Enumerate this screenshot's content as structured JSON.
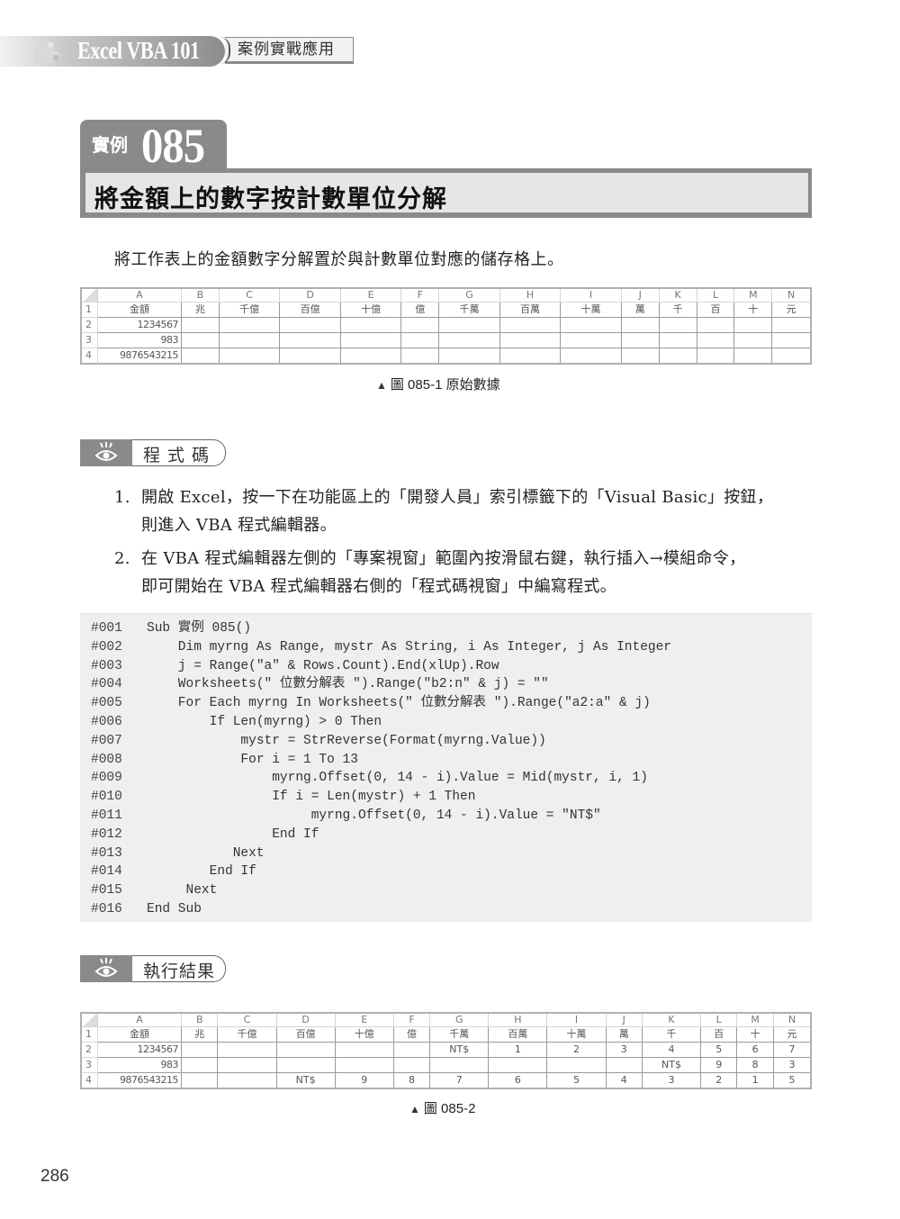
{
  "header": {
    "book_title": "Excel VBA 101",
    "book_subtitle": "案例實戰應用"
  },
  "example": {
    "label": "實例",
    "number": "085",
    "title": "將金額上的數字按計數單位分解"
  },
  "intro": "將工作表上的金額數字分解置於與計數單位對應的儲存格上。",
  "sheet_original": {
    "columns": [
      "A",
      "B",
      "C",
      "D",
      "E",
      "F",
      "G",
      "H",
      "I",
      "J",
      "K",
      "L",
      "M",
      "N"
    ],
    "rows": [
      {
        "num": "1",
        "cells": [
          "金額",
          "兆",
          "千億",
          "百億",
          "十億",
          "億",
          "千萬",
          "百萬",
          "十萬",
          "萬",
          "千",
          "百",
          "十",
          "元"
        ]
      },
      {
        "num": "2",
        "cells": [
          "1234567",
          "",
          "",
          "",
          "",
          "",
          "",
          "",
          "",
          "",
          "",
          "",
          "",
          ""
        ]
      },
      {
        "num": "3",
        "cells": [
          "983",
          "",
          "",
          "",
          "",
          "",
          "",
          "",
          "",
          "",
          "",
          "",
          "",
          ""
        ]
      },
      {
        "num": "4",
        "cells": [
          "9876543215",
          "",
          "",
          "",
          "",
          "",
          "",
          "",
          "",
          "",
          "",
          "",
          "",
          ""
        ]
      }
    ]
  },
  "caption1": {
    "marker": "▲",
    "text": "圖 085-1 原始數據"
  },
  "section_code": {
    "label": "程式碼"
  },
  "steps": [
    {
      "num": "1.",
      "line1": "開啟 Excel，按一下在功能區上的「開發人員」索引標籤下的「Visual Basic」按鈕，",
      "line2": "則進入 VBA 程式編輯器。"
    },
    {
      "num": "2.",
      "line1": "在 VBA 程式編輯器左側的「專案視窗」範圍內按滑鼠右鍵，執行插入→模組命令，",
      "line2": "即可開始在 VBA 程式編輯器右側的「程式碼視窗」中編寫程式。"
    }
  ],
  "code": [
    {
      "ln": "#001",
      "text": "Sub 實例 085()"
    },
    {
      "ln": "#002",
      "text": "    Dim myrng As Range, mystr As String, i As Integer, j As Integer"
    },
    {
      "ln": "#003",
      "text": "    j = Range(\"a\" & Rows.Count).End(xlUp).Row"
    },
    {
      "ln": "#004",
      "text": "    Worksheets(\" 位數分解表 \").Range(\"b2:n\" & j) = \"\""
    },
    {
      "ln": "#005",
      "text": "    For Each myrng In Worksheets(\" 位數分解表 \").Range(\"a2:a\" & j)"
    },
    {
      "ln": "#006",
      "text": "        If Len(myrng) > 0 Then"
    },
    {
      "ln": "#007",
      "text": "            mystr = StrReverse(Format(myrng.Value))"
    },
    {
      "ln": "#008",
      "text": "            For i = 1 To 13"
    },
    {
      "ln": "#009",
      "text": "                myrng.Offset(0, 14 - i).Value = Mid(mystr, i, 1)"
    },
    {
      "ln": "#010",
      "text": "                If i = Len(mystr) + 1 Then"
    },
    {
      "ln": "#011",
      "text": "                     myrng.Offset(0, 14 - i).Value = \"NT$\""
    },
    {
      "ln": "#012",
      "text": "                End If"
    },
    {
      "ln": "#013",
      "text": "           Next"
    },
    {
      "ln": "#014",
      "text": "        End If"
    },
    {
      "ln": "#015",
      "text": "     Next"
    },
    {
      "ln": "#016",
      "text": "End Sub"
    }
  ],
  "section_result": {
    "label": "執行結果"
  },
  "sheet_result": {
    "columns": [
      "A",
      "B",
      "C",
      "D",
      "E",
      "F",
      "G",
      "H",
      "I",
      "J",
      "K",
      "L",
      "M",
      "N"
    ],
    "rows": [
      {
        "num": "1",
        "cells": [
          "金額",
          "兆",
          "千億",
          "百億",
          "十億",
          "億",
          "千萬",
          "百萬",
          "十萬",
          "萬",
          "千",
          "百",
          "十",
          "元"
        ]
      },
      {
        "num": "2",
        "cells": [
          "1234567",
          "",
          "",
          "",
          "",
          "",
          "NT$",
          "1",
          "2",
          "3",
          "4",
          "5",
          "6",
          "7"
        ]
      },
      {
        "num": "3",
        "cells": [
          "983",
          "",
          "",
          "",
          "",
          "",
          "",
          "",
          "",
          "",
          "NT$",
          "9",
          "8",
          "3"
        ]
      },
      {
        "num": "4",
        "cells": [
          "9876543215",
          "",
          "",
          "NT$",
          "9",
          "8",
          "7",
          "6",
          "5",
          "4",
          "3",
          "2",
          "1",
          "5"
        ]
      }
    ]
  },
  "caption2": {
    "marker": "▲",
    "text": "圖 085-2"
  },
  "page_number": "286"
}
